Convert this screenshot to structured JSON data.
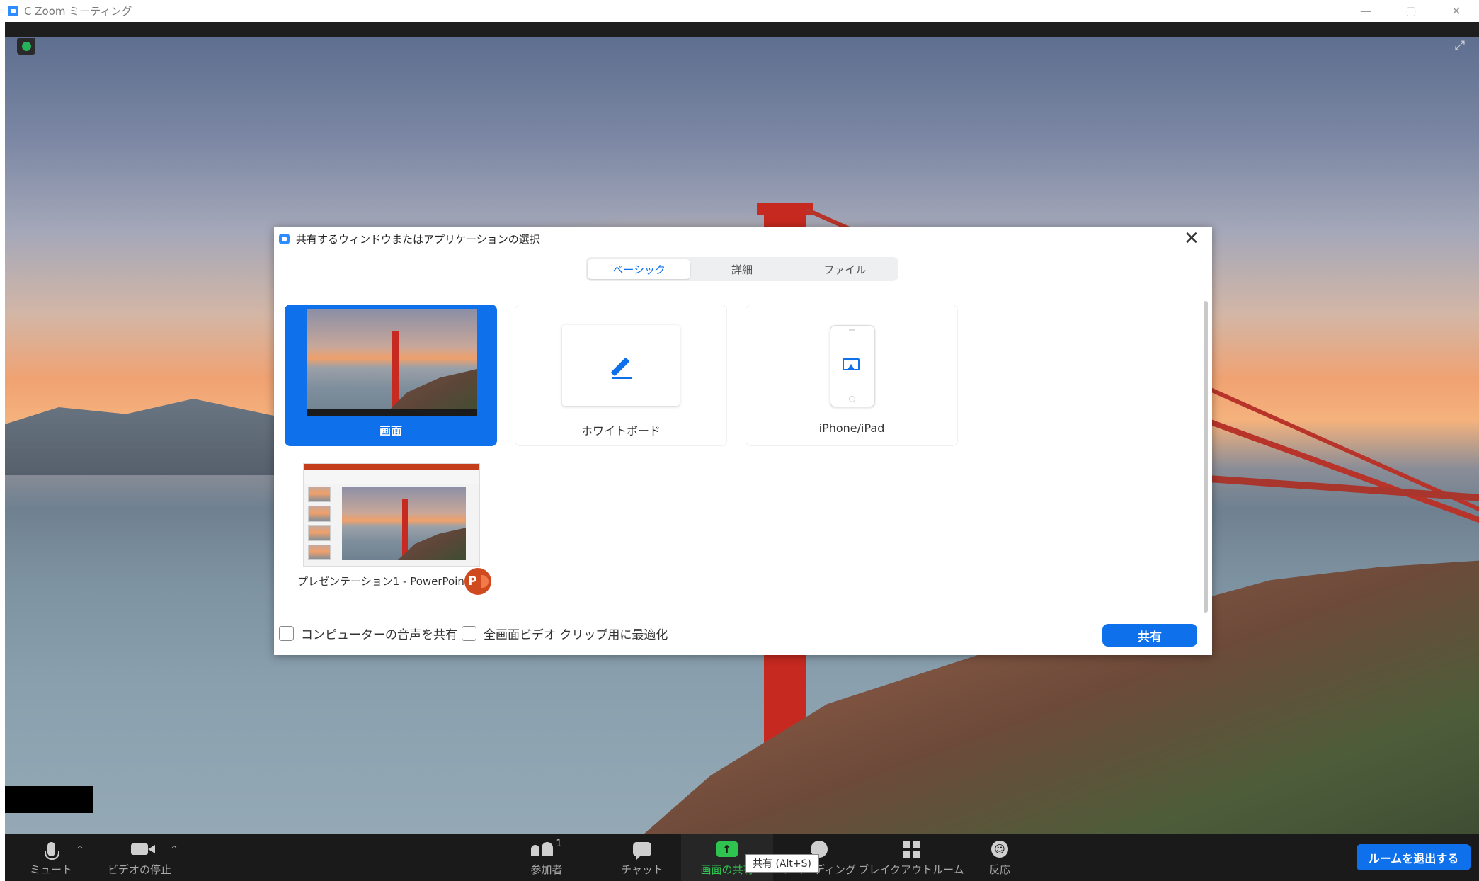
{
  "window": {
    "title": "C  Zoom ミーティング",
    "controls": [
      "—",
      "▢",
      "✕"
    ]
  },
  "dialog": {
    "title": "共有するウィンドウまたはアプリケーションの選択",
    "close": "✕",
    "tabs": [
      {
        "label": "ベーシック",
        "active": true
      },
      {
        "label": "詳細",
        "active": false
      },
      {
        "label": "ファイル",
        "active": false
      }
    ],
    "tiles": {
      "screen": {
        "label": "画面",
        "selected": true
      },
      "whiteboard": {
        "label": "ホワイトボード",
        "icon": "pen-icon"
      },
      "iphone": {
        "label": "iPhone/iPad",
        "icon": "airplay-icon"
      },
      "powerpoint": {
        "label": "プレゼンテーション1 - PowerPoint",
        "badge": "P"
      }
    },
    "options": {
      "computer_audio": "コンピューターの音声を共有",
      "optimize_video": "全画面ビデオ クリップ用に最適化"
    },
    "share_button": "共有"
  },
  "toolbar": {
    "mute": "ミュート",
    "video": "ビデオの停止",
    "participants": "参加者",
    "participants_count": "1",
    "chat": "チャット",
    "share_screen": "画面の共有",
    "recording": "レコーディング",
    "breakout": "ブレイクアウトルーム",
    "reactions": "反応",
    "leave": "ルームを退出する",
    "tooltip": "共有 (Alt+S)"
  },
  "colors": {
    "accent": "#0e71eb",
    "share_green": "#2ec44f",
    "toolbar_bg": "#1a1a1a"
  }
}
